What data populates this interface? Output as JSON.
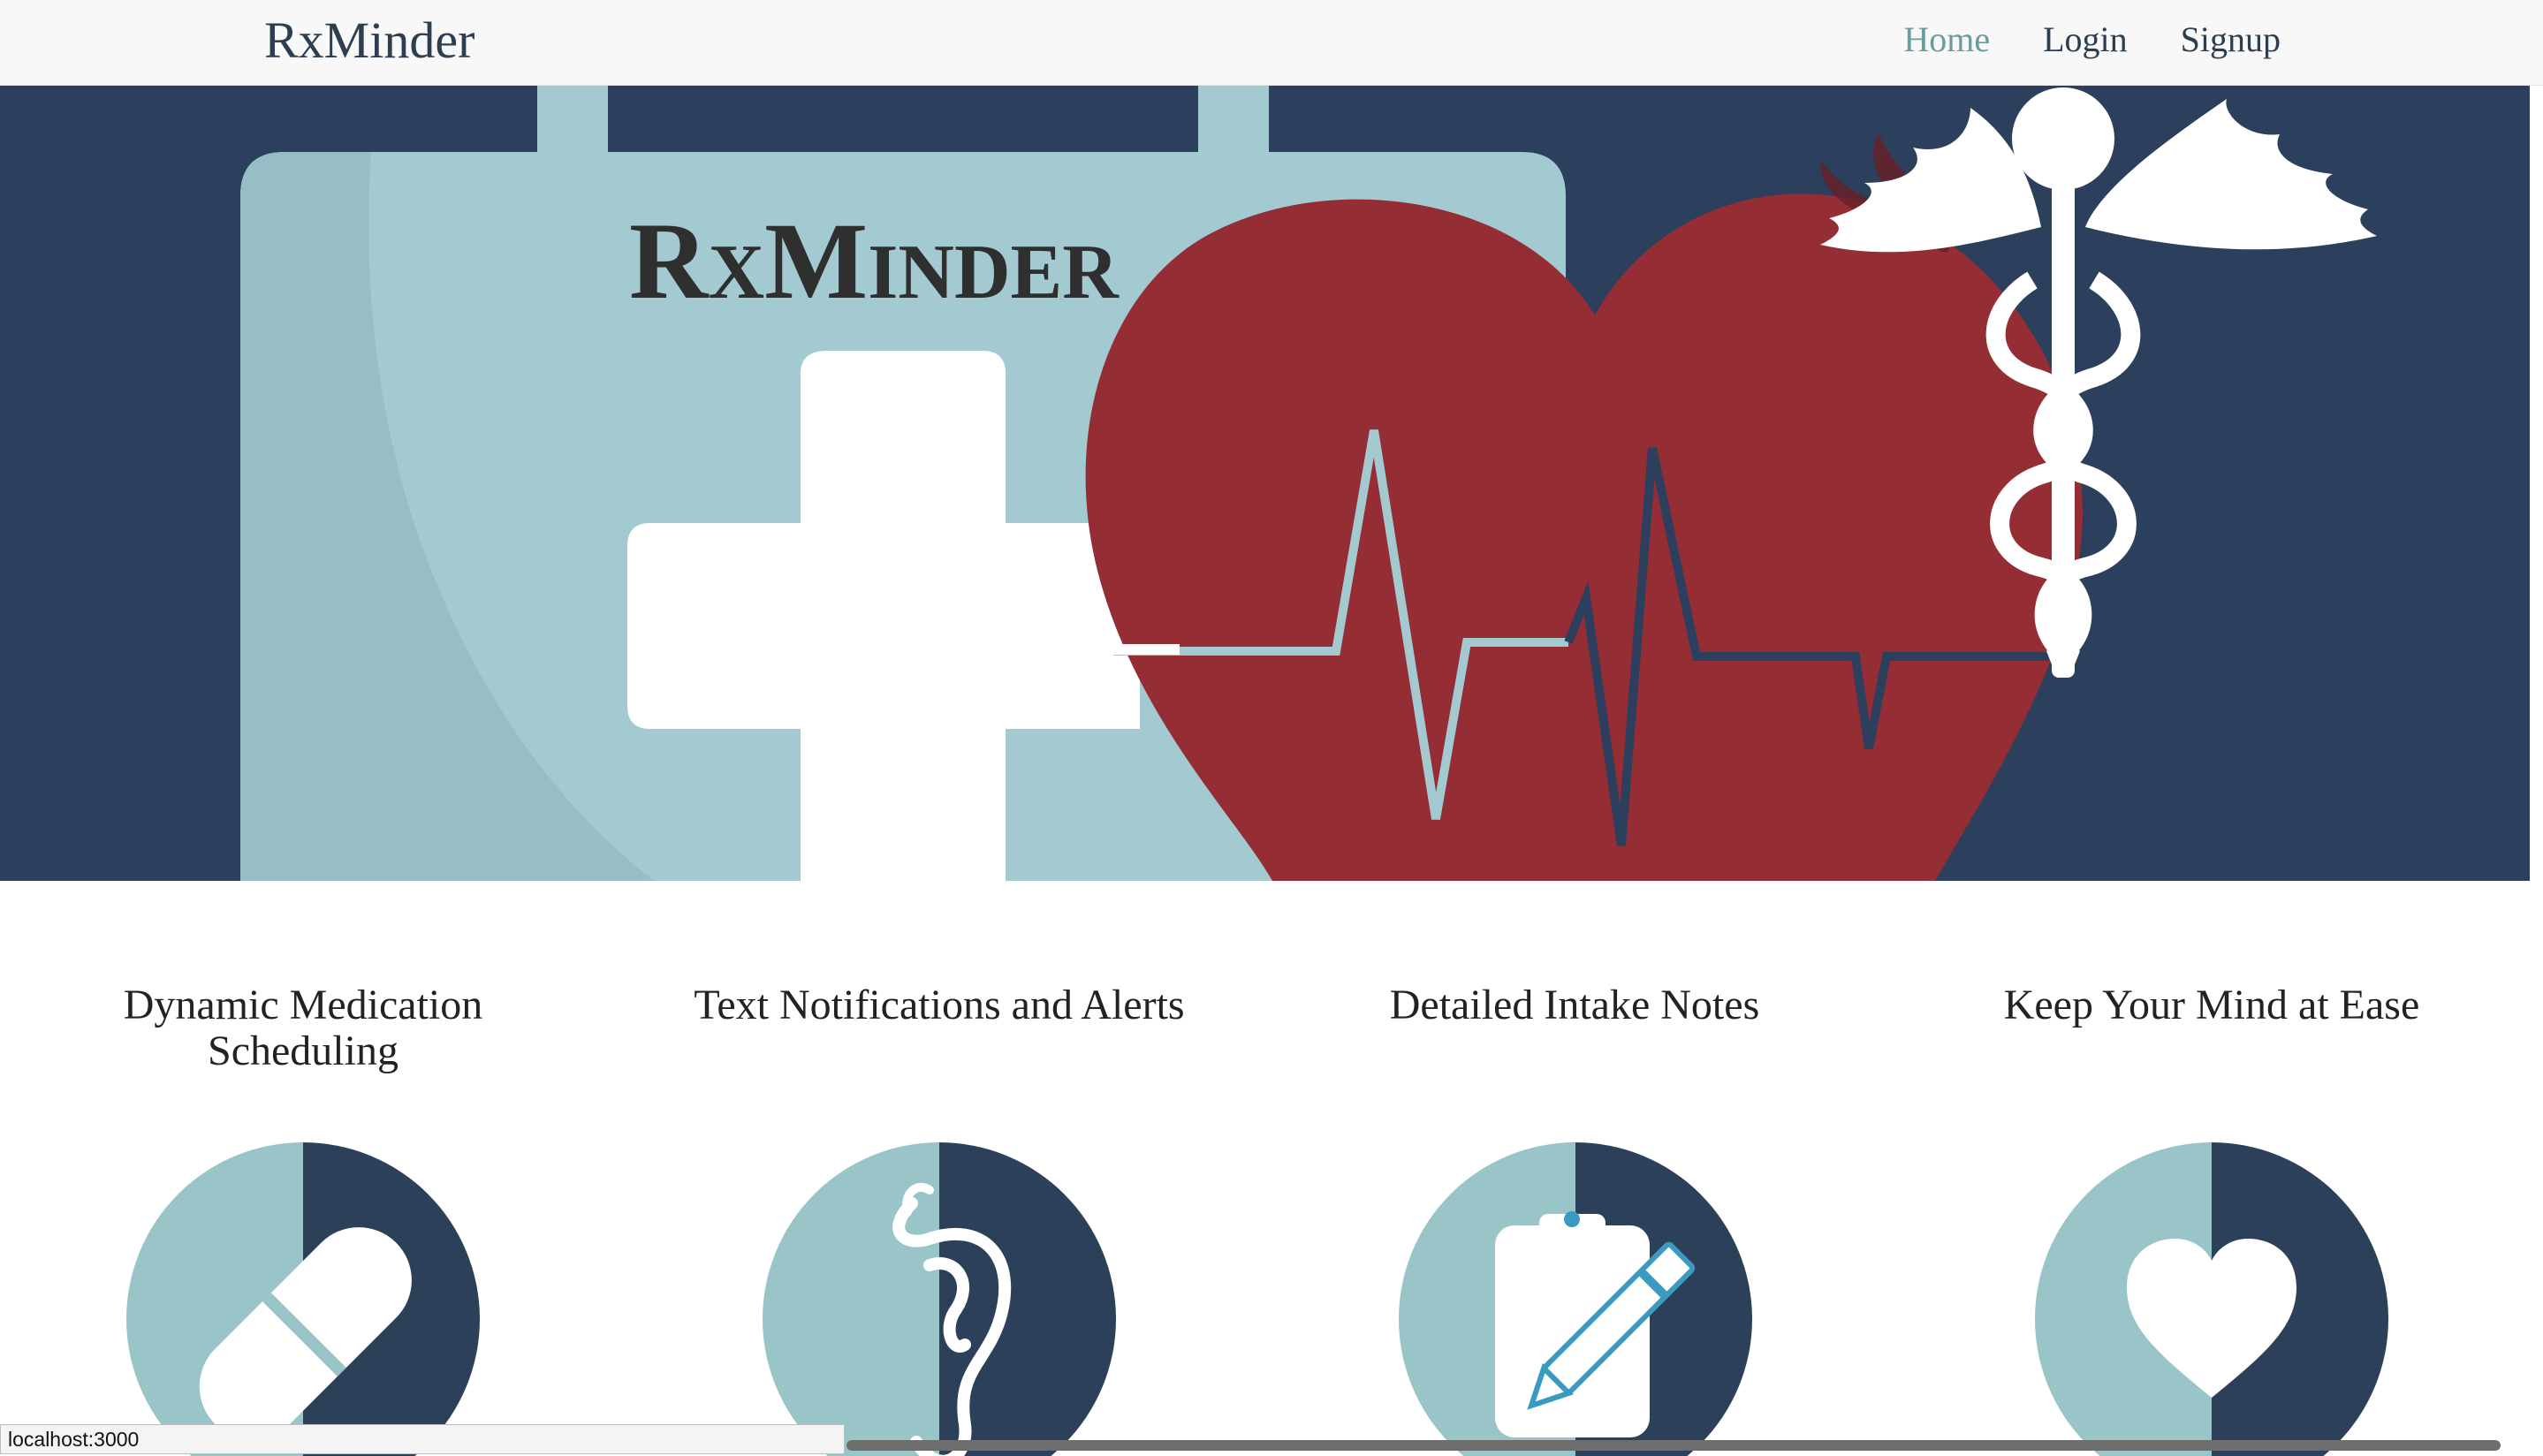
{
  "navbar": {
    "brand": "RxMinder",
    "links": [
      {
        "label": "Home",
        "active": true
      },
      {
        "label": "Login",
        "active": false
      },
      {
        "label": "Signup",
        "active": false
      }
    ]
  },
  "hero": {
    "logo_text_big_r": "R",
    "logo_text_x": "X",
    "logo_text_big_m": "M",
    "logo_text_rest": "INDER"
  },
  "features": [
    {
      "title": "Dynamic Medication Scheduling",
      "icon": "pill-icon"
    },
    {
      "title": "Text Notifications and Alerts",
      "icon": "ear-icon"
    },
    {
      "title": "Detailed Intake Notes",
      "icon": "clipboard-pencil-icon"
    },
    {
      "title": "Keep Your Mind at Ease",
      "icon": "heart-icon"
    }
  ],
  "status_bar": {
    "url": "localhost:3000"
  },
  "colors": {
    "navy": "#2c3f5c",
    "light_teal": "#a3cad0",
    "teal_circle": "#99c4c8",
    "red": "#952d35",
    "white": "#ffffff",
    "nav_active": "#6b9c9f"
  }
}
